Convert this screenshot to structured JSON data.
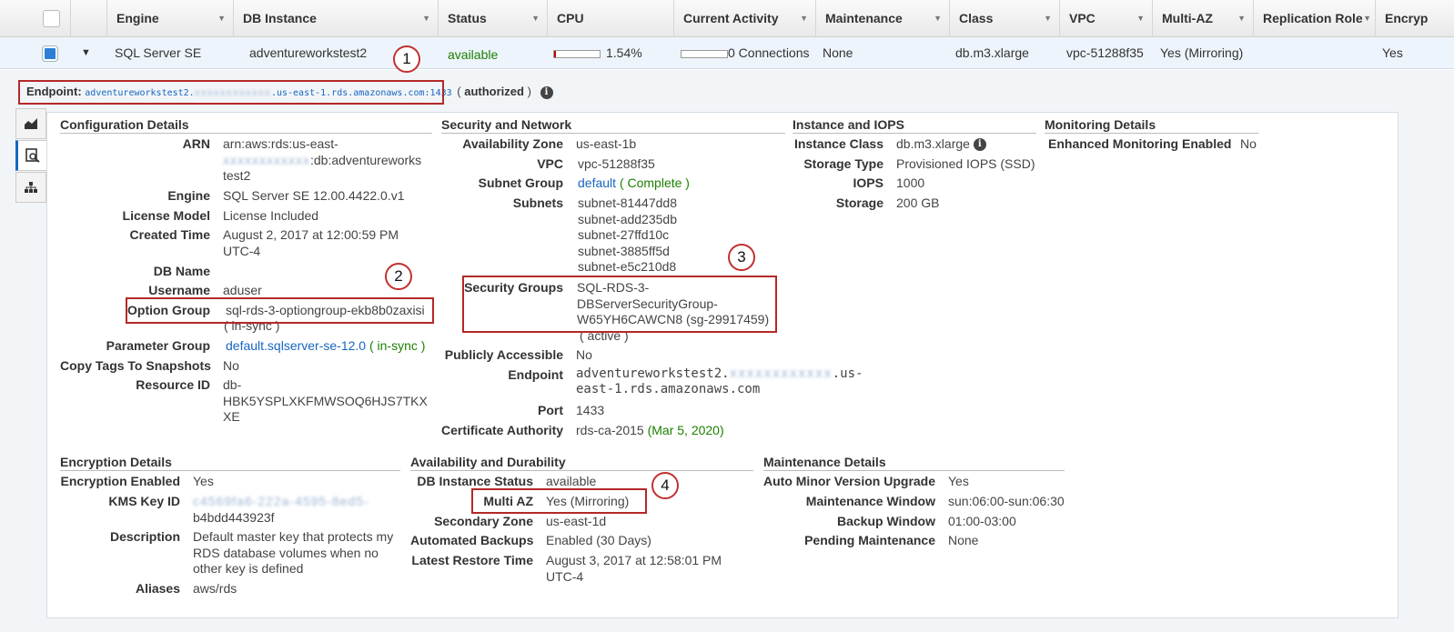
{
  "columns": [
    {
      "label": "Engine"
    },
    {
      "label": "DB Instance"
    },
    {
      "label": "Status"
    },
    {
      "label": "CPU"
    },
    {
      "label": "Current Activity"
    },
    {
      "label": "Maintenance"
    },
    {
      "label": "Class"
    },
    {
      "label": "VPC"
    },
    {
      "label": "Multi-AZ"
    },
    {
      "label": "Replication Role"
    },
    {
      "label": "Encryp"
    }
  ],
  "row": {
    "engine": "SQL Server SE",
    "instance": "adventureworkstest2",
    "status": "available",
    "cpu": "1.54%",
    "cpu_fraction": 0.0154,
    "activity": "0 Connections",
    "maintenance": "None",
    "class": "db.m3.xlarge",
    "vpc": "vpc-51288f35",
    "multi_az": "Yes (Mirroring)",
    "encrypted": "Yes"
  },
  "endpoint": {
    "label": "Endpoint:",
    "host_prefix": "adventureworkstest2.",
    "host_hidden": "xxxxxxxxxxxx",
    "host_suffix": ".us-east-1.rds.amazonaws.com:1433",
    "open_paren": "(",
    "status": "authorized",
    "close_paren": ")"
  },
  "badges": [
    "1",
    "2",
    "3",
    "4"
  ],
  "config": {
    "title": "Configuration Details",
    "arn_label": "ARN",
    "arn_line1": "arn:aws:rds:us-east-",
    "arn_hidden": "xxxxxxxxxxxx",
    "arn_line2b": ":db:adventureworks",
    "arn_line3": "test2",
    "engine_label": "Engine",
    "engine": "SQL Server SE 12.00.4422.0.v1",
    "license_label": "License Model",
    "license": "License Included",
    "created_label": "Created Time",
    "created1": "August 2, 2017 at 12:00:59 PM",
    "created2": "UTC-4",
    "dbname_label": "DB Name",
    "username_label": "Username",
    "username": "aduser",
    "optgroup_label": "Option Group",
    "optgroup": "sql-rds-3-optiongroup-ekb8b0zaxisi",
    "optgroup_sync": "( in-sync )",
    "paramgroup_label": "Parameter Group",
    "paramgroup": "default.sqlserver-se-12.0",
    "paramgroup_sync": "( in-sync )",
    "copytags_label": "Copy Tags To Snapshots",
    "copytags": "No",
    "resource_label": "Resource ID",
    "resource1": "db-",
    "resource2": "HBK5YSPLXKFMWSOQ6HJS7TKX",
    "resource3": "XE"
  },
  "security": {
    "title": "Security and Network",
    "az_label": "Availability Zone",
    "az": "us-east-1b",
    "vpc_label": "VPC",
    "vpc": "vpc-51288f35",
    "subnetgroup_label": "Subnet Group",
    "subnetgroup": "default",
    "subnetgroup_status": "( Complete )",
    "subnets_label": "Subnets",
    "subnets": [
      "subnet-81447dd8",
      "subnet-add235db",
      "subnet-27ffd10c",
      "subnet-3885ff5d",
      "subnet-e5c210d8"
    ],
    "sg_label": "Security Groups",
    "sg1": "SQL-RDS-3-",
    "sg2": "DBServerSecurityGroup-",
    "sg3": "W65YH6CAWCN8 (sg-29917459)",
    "sg_status": "( active )",
    "public_label": "Publicly Accessible",
    "public": "No",
    "endpoint_label": "Endpoint",
    "ep1": "adventureworkstest2.",
    "ep_hidden": "xxxxxxxxxxxx",
    "ep2": ".us-",
    "ep3": "east-1.rds.amazonaws.com",
    "port_label": "Port",
    "port": "1433",
    "ca_label": "Certificate Authority",
    "ca": "rds-ca-2015",
    "ca_date": "(Mar 5, 2020)"
  },
  "instance": {
    "title": "Instance and IOPS",
    "class_label": "Instance Class",
    "class": "db.m3.xlarge",
    "storage_type_label": "Storage Type",
    "storage_type": "Provisioned IOPS (SSD)",
    "iops_label": "IOPS",
    "iops": "1000",
    "storage_label": "Storage",
    "storage": "200 GB"
  },
  "monitoring": {
    "title": "Monitoring Details",
    "enhanced_label": "Enhanced Monitoring Enabled",
    "enhanced": "No"
  },
  "encryption": {
    "title": "Encryption Details",
    "enabled_label": "Encryption Enabled",
    "enabled": "Yes",
    "kms_label": "KMS Key ID",
    "kms_hidden": "c4569fa6-222a-4595-8ed5-",
    "kms2": "b4bdd443923f",
    "desc_label": "Description",
    "desc1": "Default master key that protects my",
    "desc2": "RDS database volumes when no",
    "desc3": "other key is defined",
    "aliases_label": "Aliases",
    "aliases": "aws/rds"
  },
  "availability": {
    "title": "Availability and Durability",
    "status_label": "DB Instance Status",
    "status": "available",
    "multiaz_label": "Multi AZ",
    "multiaz": "Yes (Mirroring)",
    "secondary_label": "Secondary Zone",
    "secondary": "us-east-1d",
    "backups_label": "Automated Backups",
    "backups": "Enabled (30 Days)",
    "restore_label": "Latest Restore Time",
    "restore1": "August 3, 2017 at 12:58:01 PM",
    "restore2": "UTC-4"
  },
  "maint": {
    "title": "Maintenance Details",
    "auto_label": "Auto Minor Version Upgrade",
    "auto": "Yes",
    "window_label": "Maintenance Window",
    "window": "sun:06:00-sun:06:30",
    "backup_label": "Backup Window",
    "backup": "01:00-03:00",
    "pending_label": "Pending Maintenance",
    "pending": "None"
  },
  "colors": {
    "link": "#1766c0",
    "green": "#1d8102",
    "red": "#d13212",
    "annotation": "#b52828"
  }
}
